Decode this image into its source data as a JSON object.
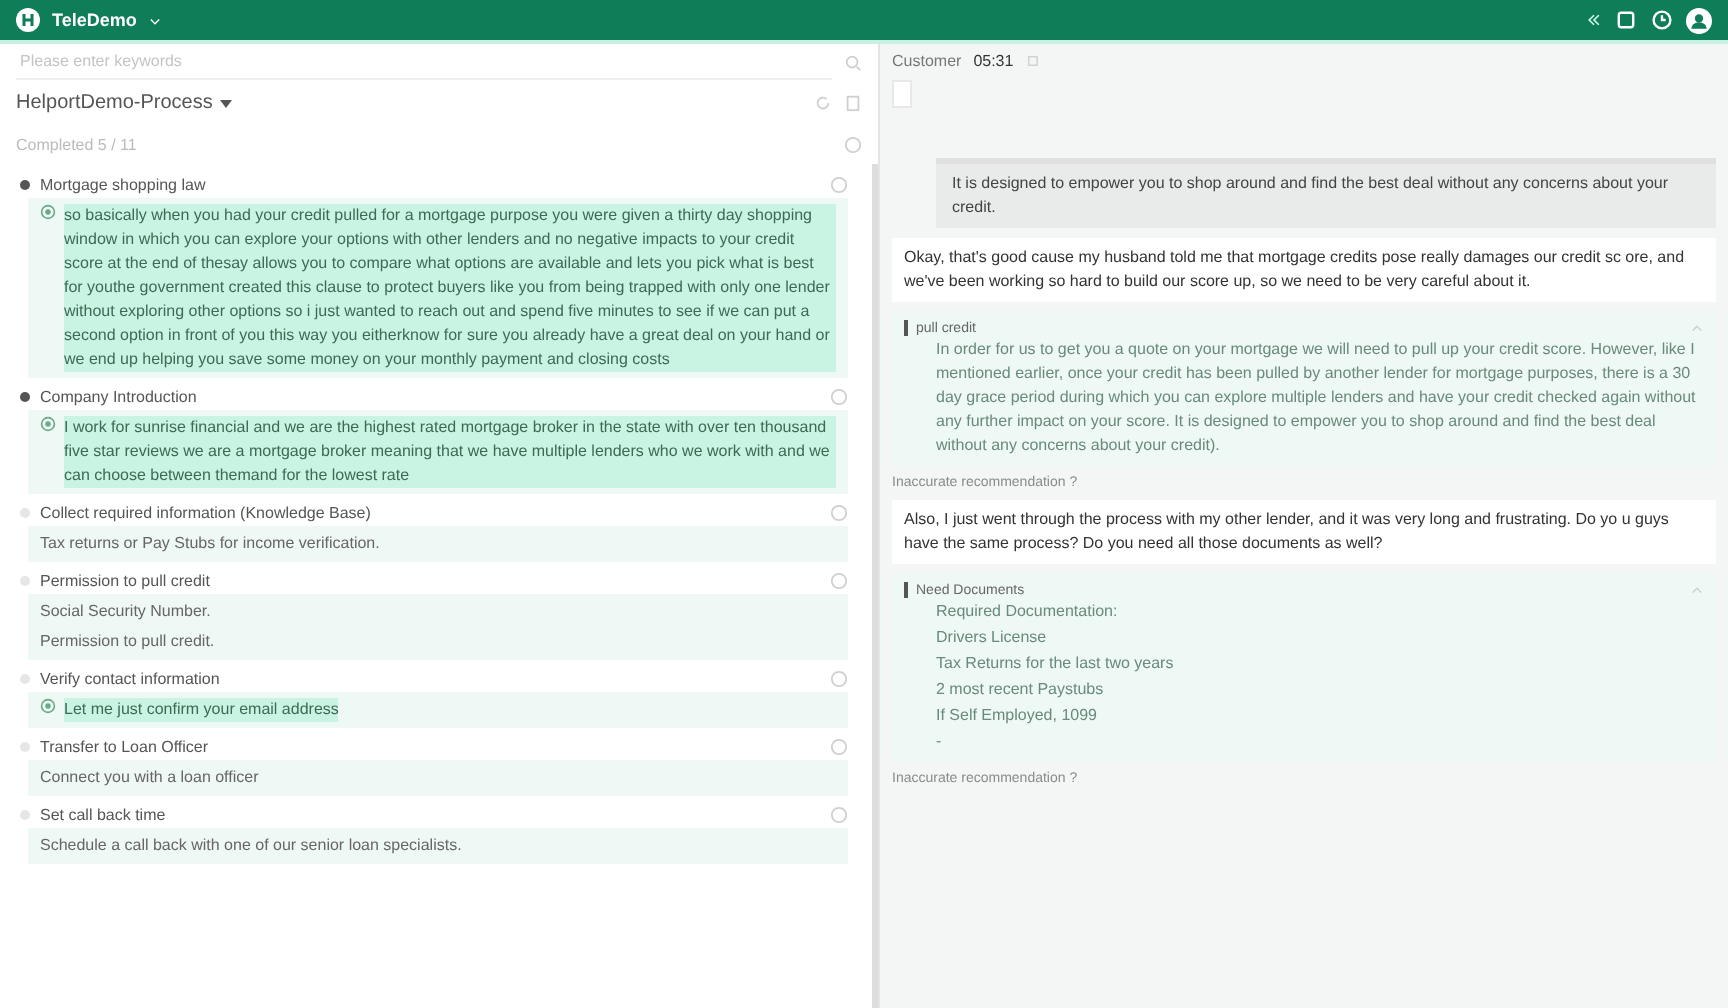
{
  "app": {
    "title": "TeleDemo"
  },
  "left": {
    "search": {
      "placeholder": "Please enter keywords"
    },
    "process": "HelportDemo-Process",
    "progress": "Completed 5 / 11",
    "steps": [
      {
        "title": "Mortgage shopping law",
        "completed": true,
        "lines": [
          {
            "kind": "script",
            "text": "so basically when you had your credit pulled for a mortgage purpose you were given a thirty day shopping window in which you can explore your options with other lenders and no negative impacts to your credit score at the end of thesay allows you to compare what options are available and lets you pick what is best for youthe government created this clause to protect buyers like you from being trapped with only one lender without exploring other options so i just wanted to reach out and spend five minutes to see if we can put a second option in front of you this way you eitherknow for sure you already have a great deal on your hand or we end up helping you save some money on your monthly payment and closing costs"
          }
        ]
      },
      {
        "title": "Company Introduction",
        "completed": true,
        "lines": [
          {
            "kind": "script",
            "text": "I work for sunrise financial and we are the highest rated mortgage broker in the state with over ten thousand five star reviews we are a mortgage broker meaning that we have multiple lenders who we work with and we can choose between themand for the lowest rate"
          }
        ]
      },
      {
        "title": "Collect required information (Knowledge Base)",
        "completed": false,
        "lines": [
          {
            "kind": "info",
            "text": "Tax returns or Pay Stubs for income verification."
          }
        ]
      },
      {
        "title": "Permission to pull credit",
        "completed": false,
        "lines": [
          {
            "kind": "info",
            "text": "Social Security Number."
          },
          {
            "kind": "info",
            "text": "Permission to pull credit."
          }
        ]
      },
      {
        "title": "Verify contact information",
        "completed": false,
        "lines": [
          {
            "kind": "script",
            "text": "Let me just confirm your email address"
          }
        ]
      },
      {
        "title": "Transfer to Loan Officer",
        "completed": false,
        "lines": [
          {
            "kind": "info",
            "text": "Connect you with a loan officer"
          }
        ]
      },
      {
        "title": "Set call back time",
        "completed": false,
        "lines": [
          {
            "kind": "info",
            "text": "Schedule a call back with one of our senior loan specialists."
          }
        ]
      }
    ]
  },
  "right": {
    "speaker": "Customer",
    "time": "05:31",
    "messages": [
      {
        "kind": "agent",
        "text": "It is designed to empower you to shop around and find the best deal without any concerns about your credit."
      },
      {
        "kind": "customer",
        "text": "Okay, that's good cause my husband told me that mortgage credits pose really damages our credit sc ore, and we've been working so hard to build our score up, so we need to be very careful about it."
      },
      {
        "kind": "card",
        "title": "pull credit",
        "lines": [
          "In order for us to get you a quote on your mortgage we will need to pull up your credit score. However, like I mentioned earlier, once your credit has been pulled by another lender for mortgage purposes, there is a 30 day grace period during which you can explore multiple lenders and have your credit checked again without any further impact on your score. It is designed to empower you to shop around and find the best deal without any concerns about your credit)."
        ]
      },
      {
        "kind": "feedback",
        "text": "Inaccurate recommendation ?"
      },
      {
        "kind": "customer",
        "text": "Also, I just went through the process with my other lender, and it was very long and frustrating. Do yo u guys have the same process? Do you need all those documents as well?"
      },
      {
        "kind": "card",
        "title": "Need Documents",
        "lines": [
          "Required Documentation:",
          "Drivers License",
          "Tax Returns for the last two years",
          "2 most recent Paystubs",
          "If Self Employed, 1099",
          "-"
        ]
      },
      {
        "kind": "feedback",
        "text": "Inaccurate recommendation ?"
      }
    ]
  }
}
